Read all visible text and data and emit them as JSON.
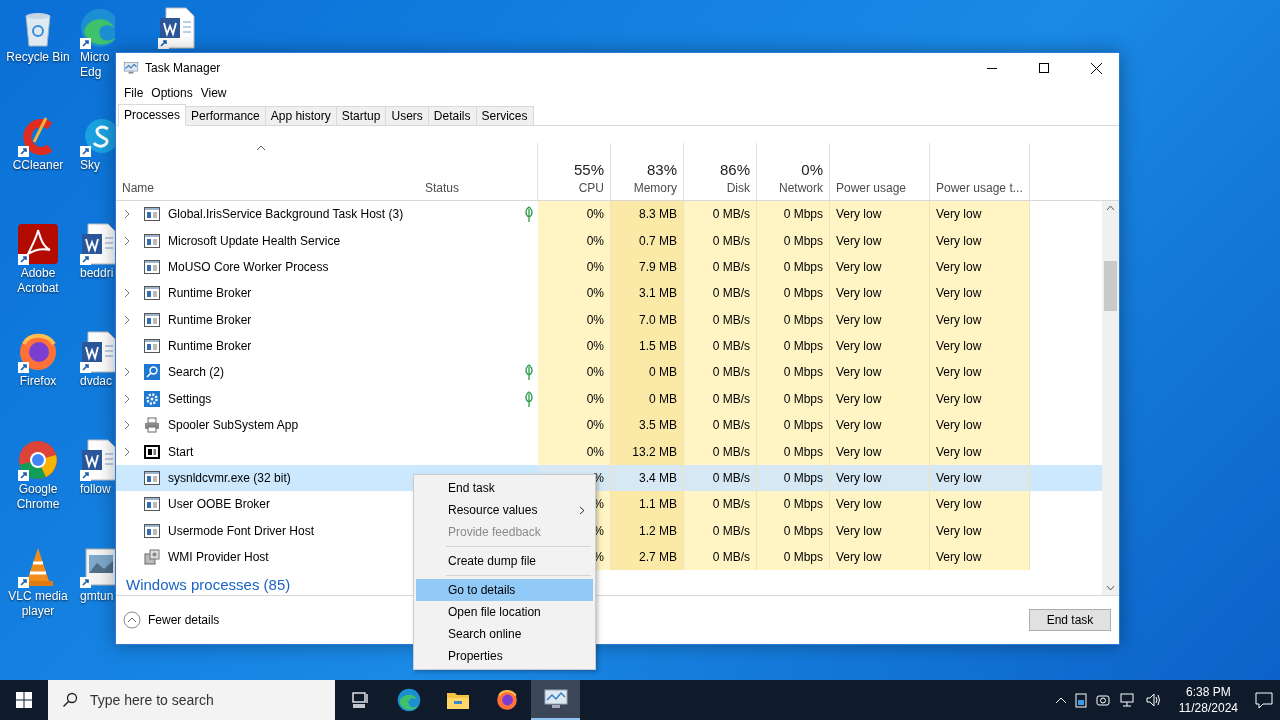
{
  "desktop_icons": [
    {
      "kind": "recycle",
      "label_lines": [
        "Recycle Bin"
      ]
    },
    {
      "kind": "ccleaner",
      "label_lines": [
        "CCleaner"
      ]
    },
    {
      "kind": "acrobat",
      "label_lines": [
        "Adobe",
        "Acrobat"
      ]
    },
    {
      "kind": "firefox",
      "label_lines": [
        "Firefox"
      ]
    },
    {
      "kind": "chrome",
      "label_lines": [
        "Google",
        "Chrome"
      ]
    },
    {
      "kind": "vlc",
      "label_lines": [
        "VLC media",
        "player"
      ]
    },
    {
      "kind": "edge",
      "label_lines": [
        "Micro",
        "Edg"
      ]
    },
    {
      "kind": "skype",
      "label_lines": [
        "Sky"
      ]
    },
    {
      "kind": "word",
      "label_lines": [
        "beddri"
      ]
    },
    {
      "kind": "word",
      "label_lines": [
        "dvdac"
      ]
    },
    {
      "kind": "word",
      "label_lines": [
        "follow"
      ]
    },
    {
      "kind": "image",
      "label_lines": [
        "gmtun"
      ]
    },
    {
      "kind": "word"
    }
  ],
  "window": {
    "title": "Task Manager"
  },
  "menu_bar": [
    "File",
    "Options",
    "View"
  ],
  "tabs": [
    {
      "label": "Processes",
      "selected": true
    },
    {
      "label": "Performance",
      "selected": false
    },
    {
      "label": "App history",
      "selected": false
    },
    {
      "label": "Startup",
      "selected": false
    },
    {
      "label": "Users",
      "selected": false
    },
    {
      "label": "Details",
      "selected": false
    },
    {
      "label": "Services",
      "selected": false
    }
  ],
  "columns": [
    {
      "label": "Name"
    },
    {
      "label": "Status"
    },
    {
      "total": "55%",
      "label": "CPU"
    },
    {
      "total": "83%",
      "label": "Memory"
    },
    {
      "total": "86%",
      "label": "Disk"
    },
    {
      "total": "0%",
      "label": "Network"
    },
    {
      "label": "Power usage"
    },
    {
      "label": "Power usage t..."
    }
  ],
  "process_rows": [
    {
      "name": "Global.IrisService Background Task Host (3)",
      "kind": "app",
      "expandable": true,
      "suspended_leaf": true,
      "selected": false,
      "cpu": "0%",
      "memory": "8.3 MB",
      "disk": "0 MB/s",
      "network": "0 Mbps",
      "power": "Very low",
      "power_trend": "Very low"
    },
    {
      "name": "Microsoft Update Health Service",
      "kind": "app",
      "expandable": true,
      "suspended_leaf": false,
      "selected": false,
      "cpu": "0%",
      "memory": "0.7 MB",
      "disk": "0 MB/s",
      "network": "0 Mbps",
      "power": "Very low",
      "power_trend": "Very low"
    },
    {
      "name": "MoUSO Core Worker Process",
      "kind": "app",
      "expandable": false,
      "suspended_leaf": false,
      "selected": false,
      "cpu": "0%",
      "memory": "7.9 MB",
      "disk": "0 MB/s",
      "network": "0 Mbps",
      "power": "Very low",
      "power_trend": "Very low"
    },
    {
      "name": "Runtime Broker",
      "kind": "app",
      "expandable": true,
      "suspended_leaf": false,
      "selected": false,
      "cpu": "0%",
      "memory": "3.1 MB",
      "disk": "0 MB/s",
      "network": "0 Mbps",
      "power": "Very low",
      "power_trend": "Very low"
    },
    {
      "name": "Runtime Broker",
      "kind": "app",
      "expandable": true,
      "suspended_leaf": false,
      "selected": false,
      "cpu": "0%",
      "memory": "7.0 MB",
      "disk": "0 MB/s",
      "network": "0 Mbps",
      "power": "Very low",
      "power_trend": "Very low"
    },
    {
      "name": "Runtime Broker",
      "kind": "app",
      "expandable": false,
      "suspended_leaf": false,
      "selected": false,
      "cpu": "0%",
      "memory": "1.5 MB",
      "disk": "0 MB/s",
      "network": "0 Mbps",
      "power": "Very low",
      "power_trend": "Very low"
    },
    {
      "name": "Search (2)",
      "kind": "search",
      "expandable": true,
      "suspended_leaf": true,
      "selected": false,
      "cpu": "0%",
      "memory": "0 MB",
      "disk": "0 MB/s",
      "network": "0 Mbps",
      "power": "Very low",
      "power_trend": "Very low"
    },
    {
      "name": "Settings",
      "kind": "settings",
      "expandable": true,
      "suspended_leaf": true,
      "selected": false,
      "cpu": "0%",
      "memory": "0 MB",
      "disk": "0 MB/s",
      "network": "0 Mbps",
      "power": "Very low",
      "power_trend": "Very low"
    },
    {
      "name": "Spooler SubSystem App",
      "kind": "printer",
      "expandable": true,
      "suspended_leaf": false,
      "selected": false,
      "cpu": "0%",
      "memory": "3.5 MB",
      "disk": "0 MB/s",
      "network": "0 Mbps",
      "power": "Very low",
      "power_trend": "Very low"
    },
    {
      "name": "Start",
      "kind": "start",
      "expandable": true,
      "suspended_leaf": false,
      "selected": false,
      "cpu": "0%",
      "memory": "13.2 MB",
      "disk": "0 MB/s",
      "network": "0 Mbps",
      "power": "Very low",
      "power_trend": "Very low"
    },
    {
      "name": "sysnldcvmr.exe (32 bit)",
      "kind": "app",
      "expandable": false,
      "suspended_leaf": false,
      "selected": true,
      "cpu": "%",
      "memory": "3.4 MB",
      "disk": "0 MB/s",
      "network": "0 Mbps",
      "power": "Very low",
      "power_trend": "Very low"
    },
    {
      "name": "User OOBE Broker",
      "kind": "app",
      "expandable": false,
      "suspended_leaf": false,
      "selected": false,
      "cpu": "%",
      "memory": "1.1 MB",
      "disk": "0 MB/s",
      "network": "0 Mbps",
      "power": "Very low",
      "power_trend": "Very low"
    },
    {
      "name": "Usermode Font Driver Host",
      "kind": "app",
      "expandable": false,
      "suspended_leaf": false,
      "selected": false,
      "cpu": "%",
      "memory": "1.2 MB",
      "disk": "0 MB/s",
      "network": "0 Mbps",
      "power": "Very low",
      "power_trend": "Very low"
    },
    {
      "name": "WMI Provider Host",
      "kind": "wmi",
      "expandable": false,
      "suspended_leaf": false,
      "selected": false,
      "cpu": "%",
      "memory": "2.7 MB",
      "disk": "0 MB/s",
      "network": "0 Mbps",
      "power": "Very low",
      "power_trend": "Very low"
    }
  ],
  "group_header": "Windows processes (85)",
  "footer": {
    "fewer_details": "Fewer details",
    "end_task": "End task"
  },
  "context_menu": [
    {
      "kind": "item",
      "label": "End task",
      "disabled": false,
      "selected": false,
      "submenu": false
    },
    {
      "kind": "item",
      "label": "Resource values",
      "disabled": false,
      "selected": false,
      "submenu": true
    },
    {
      "kind": "item",
      "label": "Provide feedback",
      "disabled": true,
      "selected": false,
      "submenu": false
    },
    {
      "kind": "separator"
    },
    {
      "kind": "item",
      "label": "Create dump file",
      "disabled": false,
      "selected": false,
      "submenu": false
    },
    {
      "kind": "separator"
    },
    {
      "kind": "item",
      "label": "Go to details",
      "disabled": false,
      "selected": true,
      "submenu": false
    },
    {
      "kind": "item",
      "label": "Open file location",
      "disabled": false,
      "selected": false,
      "submenu": false
    },
    {
      "kind": "item",
      "label": "Search online",
      "disabled": false,
      "selected": false,
      "submenu": false
    },
    {
      "kind": "item",
      "label": "Properties",
      "disabled": false,
      "selected": false,
      "submenu": false
    }
  ],
  "taskbar": {
    "search_placeholder": "Type here to search",
    "apps": [
      {
        "kind": "taskview",
        "active": false
      },
      {
        "kind": "edge",
        "active": false
      },
      {
        "kind": "folder",
        "active": false
      },
      {
        "kind": "firefox",
        "active": false
      },
      {
        "kind": "taskmgr",
        "active": true
      }
    ],
    "time": "6:38 PM",
    "date": "11/28/2024"
  }
}
